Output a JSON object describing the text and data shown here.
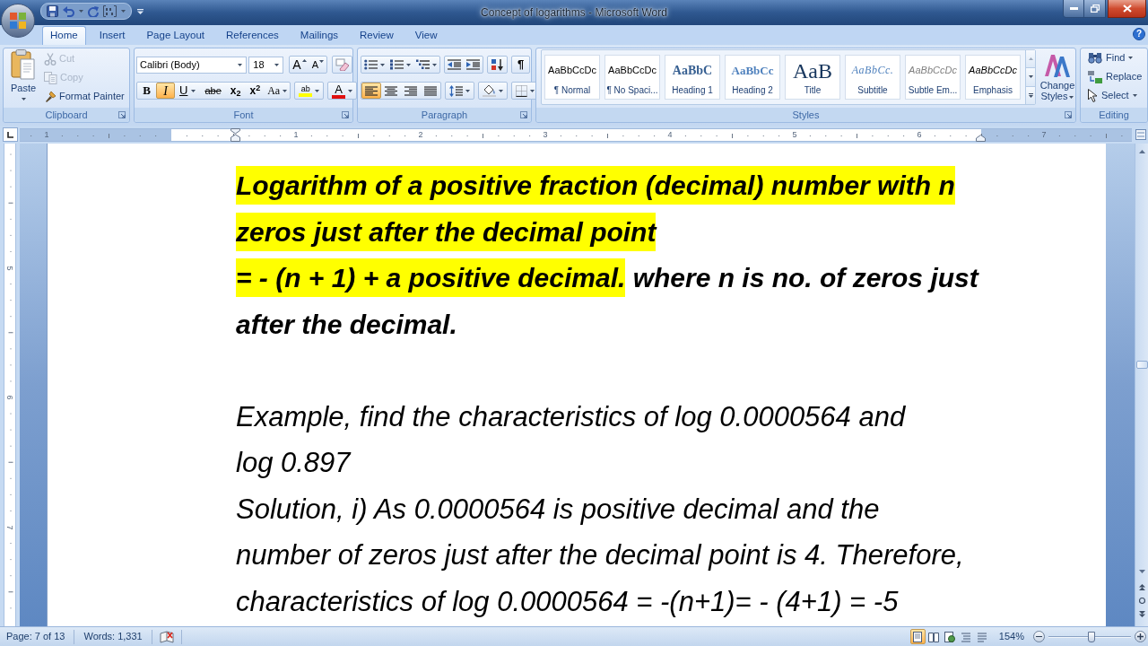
{
  "window": {
    "title": "Concept of logarithms - Microsoft Word"
  },
  "tabs": [
    {
      "label": "Home",
      "selected": true
    },
    {
      "label": "Insert",
      "selected": false
    },
    {
      "label": "Page Layout",
      "selected": false
    },
    {
      "label": "References",
      "selected": false
    },
    {
      "label": "Mailings",
      "selected": false
    },
    {
      "label": "Review",
      "selected": false
    },
    {
      "label": "View",
      "selected": false
    }
  ],
  "help": "?",
  "clipboard": {
    "label": "Clipboard",
    "paste": "Paste",
    "items": [
      {
        "kind": "cut",
        "label": "Cut",
        "disabled": true
      },
      {
        "kind": "copy",
        "label": "Copy",
        "disabled": true
      },
      {
        "kind": "format_painter",
        "label": "Format Painter",
        "disabled": false
      }
    ]
  },
  "font": {
    "label": "Font",
    "font_name": "Calibri (Body)",
    "font_size": "18",
    "grow": "A",
    "shrink": "A",
    "format_buttons": [
      {
        "kind": "bold",
        "label": "B",
        "selected": false
      },
      {
        "kind": "italic",
        "label": "I",
        "selected": true
      },
      {
        "kind": "underline",
        "label": "U",
        "selected": false
      },
      {
        "kind": "strikethrough",
        "label": "abe",
        "selected": false
      },
      {
        "kind": "subscript",
        "label": "x$_{2}$",
        "selected": false
      },
      {
        "kind": "superscript",
        "label": "x$^{2}$",
        "selected": false
      }
    ],
    "change_case": "Aa",
    "highlight": "ab",
    "font_color": "A"
  },
  "paragraph": {
    "label": "Paragraph",
    "show_marks": "¶",
    "alignment": [
      {
        "kind": "left",
        "selected": true
      },
      {
        "kind": "center",
        "selected": false
      },
      {
        "kind": "right",
        "selected": false
      },
      {
        "kind": "justify",
        "selected": false
      }
    ]
  },
  "styles": {
    "label": "Styles",
    "gallery": [
      {
        "kind": "normal",
        "preview": "AaBbCcDc",
        "name": "¶ Normal"
      },
      {
        "kind": "no_spacing",
        "preview": "AaBbCcDc",
        "name": "¶ No Spaci..."
      },
      {
        "kind": "heading1",
        "preview": "AaBbC",
        "name": "Heading 1"
      },
      {
        "kind": "heading2",
        "preview": "AaBbCc",
        "name": "Heading 2"
      },
      {
        "kind": "title",
        "preview": "AaB",
        "name": "Title"
      },
      {
        "kind": "subtitle",
        "preview": "AaBbCc.",
        "name": "Subtitle"
      },
      {
        "kind": "subtle_emphasis",
        "preview": "AaBbCcDc",
        "name": "Subtle Em..."
      },
      {
        "kind": "emphasis",
        "preview": "AaBbCcDc",
        "name": "Emphasis"
      }
    ],
    "change_styles": "Change Styles"
  },
  "editing": {
    "label": "Editing",
    "items": [
      {
        "kind": "find",
        "label": "Find"
      },
      {
        "kind": "replace",
        "label": "Replace"
      },
      {
        "kind": "select",
        "label": "Select"
      }
    ]
  },
  "ruler": {
    "left_labels": [
      "1"
    ],
    "labels": [
      "1",
      "2",
      "3",
      "4",
      "5",
      "6",
      "7"
    ]
  },
  "vertical_ruler": {
    "labels": [
      "5",
      "6",
      "7"
    ]
  },
  "document": {
    "paragraphs": [
      {
        "kind": "bold_italic",
        "lines": [
          [
            {
              "text": "Logarithm of a positive fraction (decimal) number with n",
              "highlight": true
            }
          ],
          [
            {
              "text": "zeros just after the decimal point",
              "highlight": true
            }
          ]
        ]
      },
      {
        "kind": "bold_italic",
        "lines": [
          [
            {
              "text": "= - (n + 1) + a positive decimal.",
              "highlight": true
            },
            {
              "text": " where n is no. of zeros just",
              "highlight": false
            }
          ],
          [
            {
              "text": "after the decimal.",
              "highlight": false
            }
          ]
        ]
      },
      {
        "kind": "blank"
      },
      {
        "kind": "italic",
        "lines": [
          [
            {
              "text": "Example, find the characteristics of log 0.0000564 and",
              "highlight": false
            }
          ],
          [
            {
              "text": "log 0.897",
              "highlight": false
            }
          ]
        ]
      },
      {
        "kind": "italic",
        "lines": [
          [
            {
              "text": "Solution, i) As 0.0000564 is positive decimal and the",
              "highlight": false
            }
          ],
          [
            {
              "text": "number of zeros just after the decimal point is 4. Therefore,",
              "highlight": false
            }
          ],
          [
            {
              "text": "characteristics of log 0.0000564 = -(n+1)= - (4+1) = -5",
              "highlight": false
            }
          ]
        ]
      }
    ]
  },
  "status_bar": {
    "page": "Page: 7 of 13",
    "words": "Words: 1,331",
    "views": [
      {
        "kind": "print_layout",
        "selected": true
      },
      {
        "kind": "full_screen_reading",
        "selected": false
      },
      {
        "kind": "web_layout",
        "selected": false
      },
      {
        "kind": "outline",
        "selected": false
      },
      {
        "kind": "draft",
        "selected": false
      }
    ],
    "zoom": "154%",
    "zoom_slider": {
      "level": 0.52
    }
  }
}
